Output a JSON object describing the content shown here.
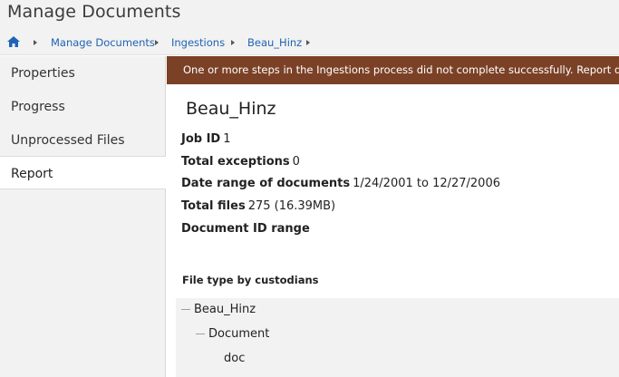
{
  "page": {
    "title": "Manage Documents"
  },
  "breadcrumb": {
    "home_icon": "home-icon",
    "items": [
      "Manage Documents",
      "Ingestions",
      "Beau_Hinz"
    ]
  },
  "sidebar": {
    "items": [
      {
        "label": "Properties",
        "active": false
      },
      {
        "label": "Progress",
        "active": false
      },
      {
        "label": "Unprocessed Files",
        "active": false
      },
      {
        "label": "Report",
        "active": true
      }
    ]
  },
  "banner": {
    "text": "One or more steps in the Ingestions process did not complete successfully. Report details",
    "color": "#7b4126"
  },
  "report": {
    "title": "Beau_Hinz",
    "fields": [
      {
        "key": "Job ID",
        "value": "1"
      },
      {
        "key": "Total exceptions",
        "value": "0"
      },
      {
        "key": "Date range of documents",
        "value": "1/24/2001 to 12/27/2006"
      },
      {
        "key": "Total files",
        "value": "275 (16.39MB)"
      },
      {
        "key": "Document ID range",
        "value": ""
      }
    ],
    "section_title": "File type by custodians",
    "tree": [
      {
        "label": "Beau_Hinz",
        "level": 0
      },
      {
        "label": "Document",
        "level": 1
      },
      {
        "label": "doc",
        "level": 2
      }
    ]
  },
  "colors": {
    "accent_link": "#1f63b3",
    "banner_bg": "#7b4126",
    "panel_bg": "#f2f2f2"
  }
}
